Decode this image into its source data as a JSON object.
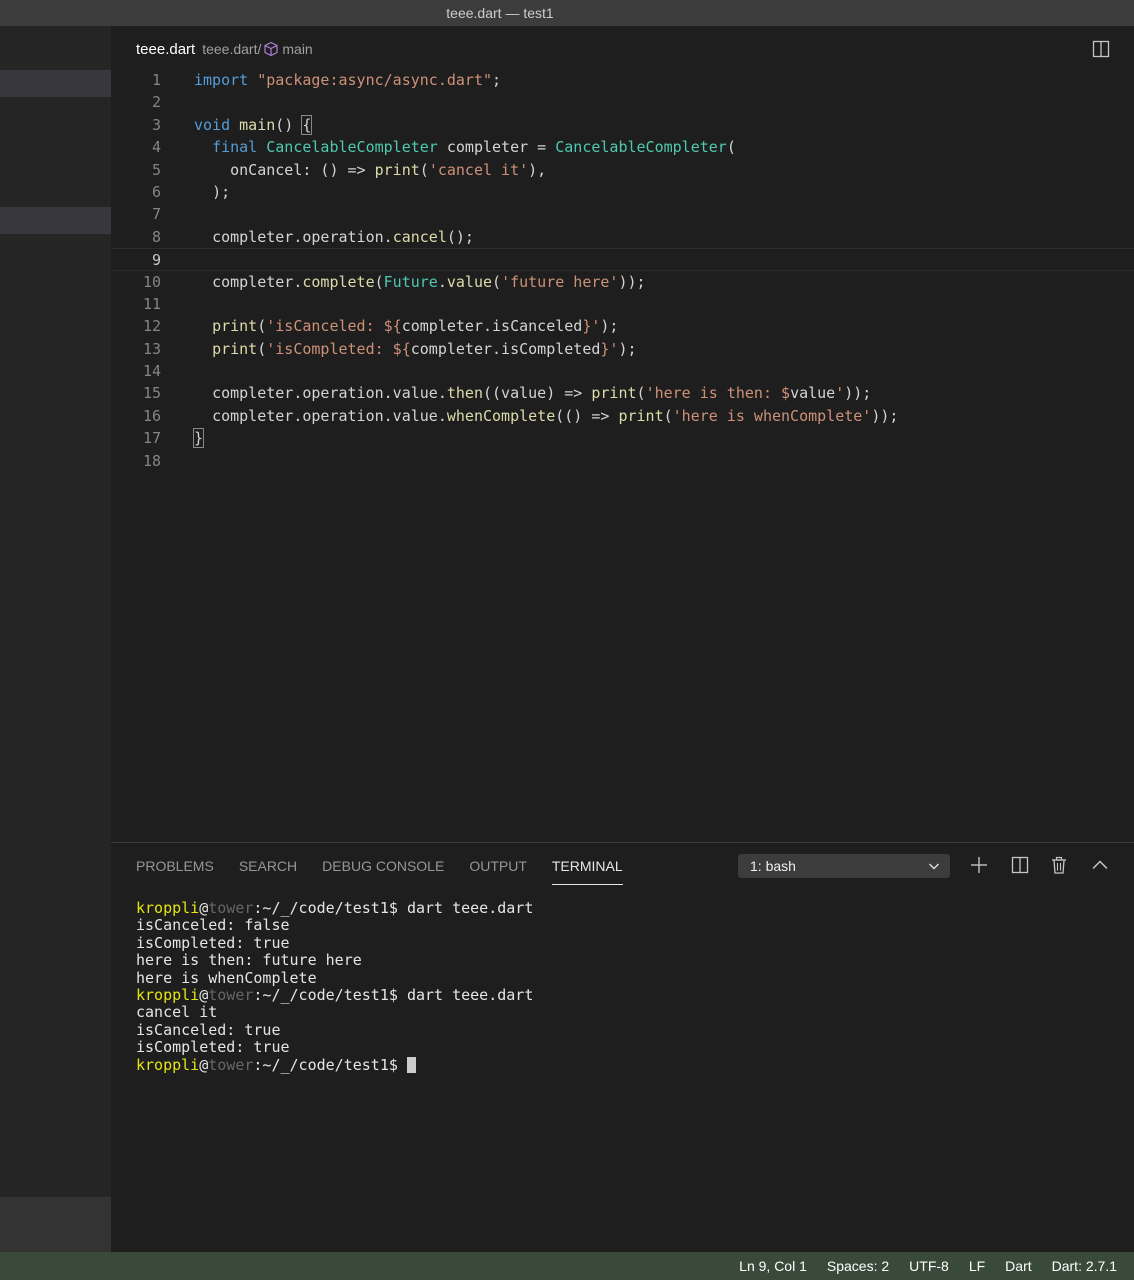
{
  "window": {
    "title": "teee.dart — test1"
  },
  "breadcrumb": {
    "file": "teee.dart",
    "path": "teee.dart/",
    "symbol": "main"
  },
  "editor": {
    "line_numbers": [
      "1",
      "2",
      "3",
      "4",
      "5",
      "6",
      "7",
      "8",
      "9",
      "10",
      "11",
      "12",
      "13",
      "14",
      "15",
      "16",
      "17",
      "18"
    ],
    "current_line": 9,
    "code": {
      "l1_import": "import",
      "l1_pkg": "\"package:async/async.dart\"",
      "l1_end": ";",
      "l3_void": "void",
      "l3_main": "main",
      "l3_parens": "() ",
      "l3_brace": "{",
      "l4_final": "final",
      "l4_type": "CancelableCompleter",
      "l4_mid": " completer = ",
      "l4_ctor": "CancelableCompleter",
      "l4_end": "(",
      "l5_onCancel": "onCancel: () => ",
      "l5_print": "print",
      "l5_open": "(",
      "l5_str": "'cancel it'",
      "l5_end": "),",
      "l6": ");",
      "l8_pre": "completer.operation.",
      "l8_fn": "cancel",
      "l8_end": "();",
      "l10_pre": "completer.",
      "l10_fn": "complete",
      "l10_open": "(",
      "l10_future": "Future",
      "l10_dot": ".",
      "l10_value": "value",
      "l10_open2": "(",
      "l10_str": "'future here'",
      "l10_end": "));",
      "l12_print": "print",
      "l12_open": "(",
      "l12_str1": "'isCanceled: ${",
      "l12_expr": "completer.isCanceled",
      "l12_str2": "}'",
      "l12_end": ");",
      "l13_print": "print",
      "l13_open": "(",
      "l13_str1": "'isCompleted: ${",
      "l13_expr": "completer.isCompleted",
      "l13_str2": "}'",
      "l13_end": ");",
      "l15_pre": "completer.operation.value.",
      "l15_then": "then",
      "l15_mid": "((value) => ",
      "l15_print": "print",
      "l15_open": "(",
      "l15_str1": "'here is then: $",
      "l15_var": "value",
      "l15_str2": "'",
      "l15_end": "));",
      "l16_pre": "completer.operation.value.",
      "l16_fn": "whenComplete",
      "l16_mid": "(() => ",
      "l16_print": "print",
      "l16_open": "(",
      "l16_str": "'here is whenComplete'",
      "l16_end": "));",
      "l17": "}"
    }
  },
  "panel": {
    "tabs": [
      "PROBLEMS",
      "SEARCH",
      "DEBUG CONSOLE",
      "OUTPUT",
      "TERMINAL"
    ],
    "active_tab": "TERMINAL",
    "terminal_select": "1: bash",
    "prompt": {
      "user": "kroppli",
      "at": "@",
      "host": "tower",
      "path": ":~/_/code/test1$ "
    },
    "terminal_lines": {
      "cmd1": "dart teee.dart",
      "o1": "isCanceled: false",
      "o2": "isCompleted: true",
      "o3": "here is then: future here",
      "o4": "here is whenComplete",
      "cmd2": "dart teee.dart",
      "o5": "cancel it",
      "o6": "isCanceled: true",
      "o7": "isCompleted: true"
    }
  },
  "statusbar": {
    "position": "Ln 9, Col 1",
    "spaces": "Spaces: 2",
    "encoding": "UTF-8",
    "eol": "LF",
    "language": "Dart",
    "sdk": "Dart: 2.7.1"
  },
  "icons": {
    "breadcrumb_symbol": "cube-icon",
    "split_editor": "split-editor-icon",
    "new_terminal": "plus-icon",
    "split_terminal": "split-terminal-icon",
    "kill_terminal": "trash-icon",
    "maximize_panel": "chevron-up-icon",
    "dropdown": "chevron-down-icon"
  },
  "colors": {
    "keyword": "#569cd6",
    "string": "#ce9178",
    "function": "#dcdcaa",
    "type": "#4ec9b0",
    "prompt_user": "#e5e510",
    "statusbar": "#3a4a3a"
  }
}
